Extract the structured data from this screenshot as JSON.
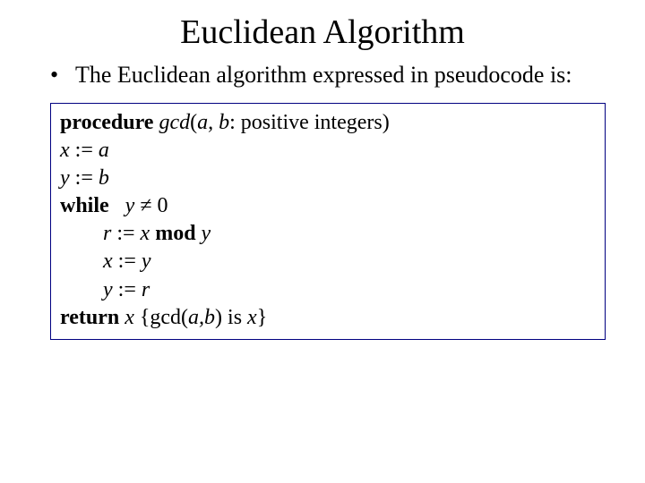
{
  "title": "Euclidean Algorithm",
  "bullet": "The Euclidean algorithm expressed in pseudocode is:",
  "code": {
    "kw_procedure": "procedure",
    "proc_name": "gcd",
    "proc_args_open": "(",
    "proc_args_ab": "a, b",
    "proc_args_rest": ": positive integers)",
    "line_x": "x ",
    "assign": ":= ",
    "a": "a",
    "line_y": "y ",
    "b": "b",
    "kw_while": "while",
    "while_sp": "   ",
    "while_var": "y ",
    "neq": "≠",
    "zero": " 0",
    "r": "r ",
    "x": "x ",
    "kw_mod": "mod",
    "mod_sp": " ",
    "y": "y",
    "y2": "y ",
    "r2": "r",
    "kw_return": "return",
    "ret_sp": " ",
    "ret_var": "x ",
    "ret_comment": "{gcd(",
    "ret_ab": "a,b",
    "ret_comment2": ") is ",
    "ret_x": "x",
    "ret_close": "}"
  }
}
